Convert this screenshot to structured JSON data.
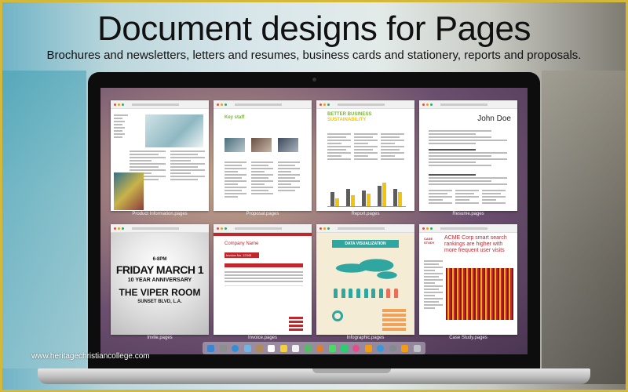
{
  "headline": "Document designs for Pages",
  "subline": "Brochures and newsletters, letters and resumes, business cards and stationery, reports and proposals.",
  "watermark": "www.heritagechristiancollege.com",
  "templates": [
    {
      "caption": "Product Information.pages"
    },
    {
      "caption": "Proposal.pages",
      "heading": "Key staff"
    },
    {
      "caption": "Report.pages",
      "heading": "BETTER BUSINESS",
      "subheading": "SUSTAINABILITY"
    },
    {
      "caption": "Resume.pages",
      "heading": "John Doe"
    },
    {
      "caption": "Invite.pages",
      "line1": "6-8PM",
      "line2": "FRIDAY MARCH 1",
      "line3": "10 YEAR ANNIVERSARY",
      "line4": "THE VIPER ROOM",
      "line5": "SUNSET BLVD, L.A."
    },
    {
      "caption": "Invoice.pages",
      "heading": "Company Name",
      "subheading": "Invoice No. 12345"
    },
    {
      "caption": "Infographic.pages",
      "heading": "DATA VISUALIZATION"
    },
    {
      "caption": "Case Study.pages",
      "tag": "CASE STUDY",
      "heading": "ACME Corp smart search rankings are higher with more frequent user visits"
    }
  ],
  "dock_icons": [
    "finder-icon",
    "launchpad-icon",
    "safari-icon",
    "mail-icon",
    "contacts-icon",
    "calendar-icon",
    "notes-icon",
    "reminders-icon",
    "maps-icon",
    "photos-icon",
    "messages-icon",
    "facetime-icon",
    "itunes-icon",
    "ibooks-icon",
    "appstore-icon",
    "preferences-icon",
    "pages-icon",
    "trash-icon"
  ],
  "colors": {
    "accent_border": "#d4b83a",
    "invoice_red": "#c0262c",
    "proposal_green": "#7cb342",
    "report_yellow": "#f1c40f"
  }
}
